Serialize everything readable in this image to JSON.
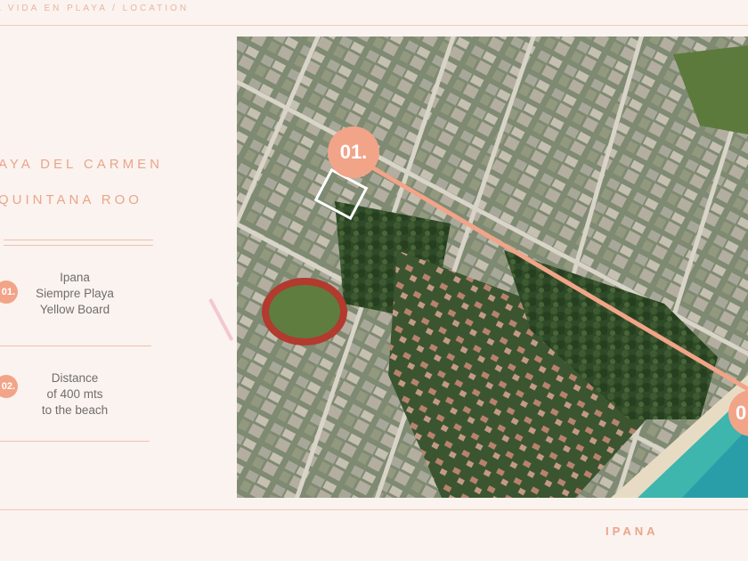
{
  "header": {
    "breadcrumb": "A VIDA EN PLAYA / LOCATION"
  },
  "location": {
    "city": "AYA DEL CARMEN",
    "state": "QUINTANA ROO"
  },
  "points": [
    {
      "badge": "01.",
      "lines": [
        "Ipana",
        "Siempre Playa",
        "Yellow Board"
      ]
    },
    {
      "badge": "02.",
      "lines": [
        "Distance",
        "of 400 mts",
        "to the beach"
      ]
    }
  ],
  "map": {
    "marker_1": "01.",
    "marker_2": "0",
    "accent_color": "#f2a488"
  },
  "footer": {
    "brand": "IPANA"
  }
}
